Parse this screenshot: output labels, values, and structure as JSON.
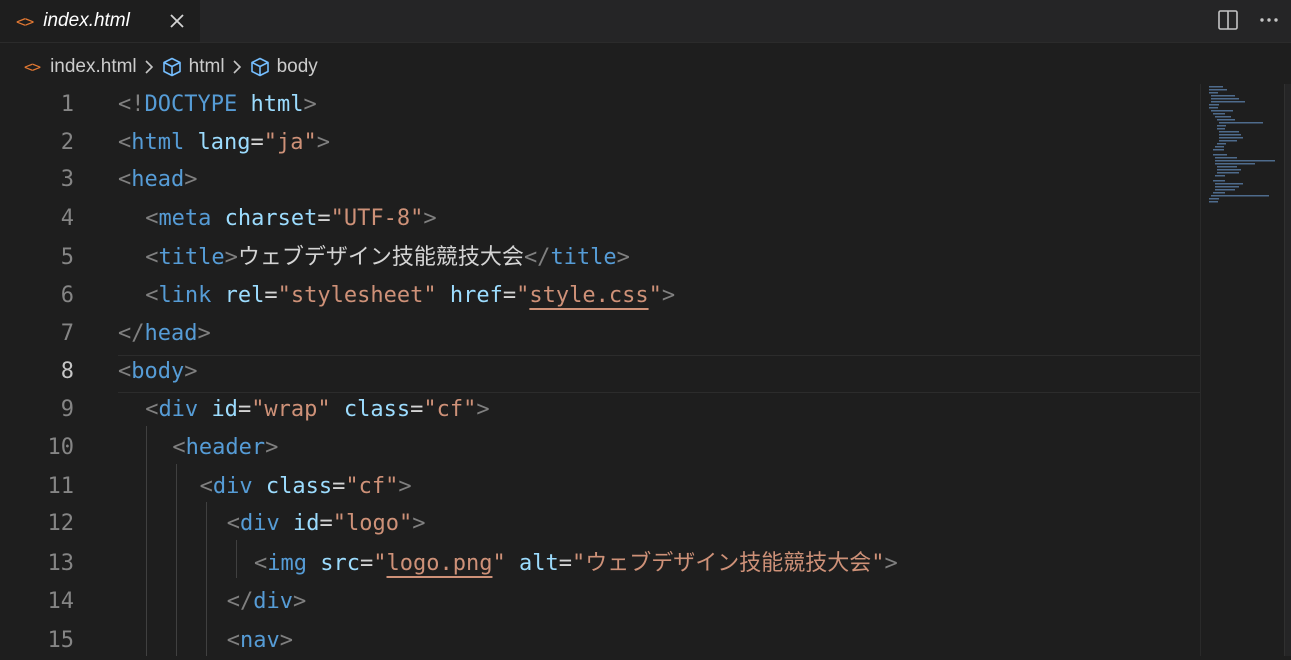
{
  "tab": {
    "label": "index.html",
    "icon": "html-file-icon"
  },
  "breadcrumb": {
    "file": "index.html",
    "items": [
      "html",
      "body"
    ]
  },
  "lines": [
    {
      "n": "1",
      "indent": 0,
      "tokens": [
        [
          "p",
          "<!"
        ],
        [
          "t",
          "DOCTYPE"
        ],
        [
          "e",
          " "
        ],
        [
          "a",
          "html"
        ],
        [
          "p",
          ">"
        ]
      ]
    },
    {
      "n": "2",
      "indent": 0,
      "tokens": [
        [
          "p",
          "<"
        ],
        [
          "t",
          "html"
        ],
        [
          "e",
          " "
        ],
        [
          "a",
          "lang"
        ],
        [
          "e",
          "="
        ],
        [
          "s",
          "\"ja\""
        ],
        [
          "p",
          ">"
        ]
      ]
    },
    {
      "n": "3",
      "indent": 0,
      "tokens": [
        [
          "p",
          "<"
        ],
        [
          "t",
          "head"
        ],
        [
          "p",
          ">"
        ]
      ]
    },
    {
      "n": "4",
      "indent": 2,
      "tokens": [
        [
          "p",
          "<"
        ],
        [
          "t",
          "meta"
        ],
        [
          "e",
          " "
        ],
        [
          "a",
          "charset"
        ],
        [
          "e",
          "="
        ],
        [
          "s",
          "\"UTF-8\""
        ],
        [
          "p",
          ">"
        ]
      ]
    },
    {
      "n": "5",
      "indent": 2,
      "tokens": [
        [
          "p",
          "<"
        ],
        [
          "t",
          "title"
        ],
        [
          "p",
          ">"
        ],
        [
          "tx",
          "ウェブデザイン技能競技大会"
        ],
        [
          "p",
          "</"
        ],
        [
          "t",
          "title"
        ],
        [
          "p",
          ">"
        ]
      ]
    },
    {
      "n": "6",
      "indent": 2,
      "tokens": [
        [
          "p",
          "<"
        ],
        [
          "t",
          "link"
        ],
        [
          "e",
          " "
        ],
        [
          "a",
          "rel"
        ],
        [
          "e",
          "="
        ],
        [
          "s",
          "\"stylesheet\""
        ],
        [
          "e",
          " "
        ],
        [
          "a",
          "href"
        ],
        [
          "e",
          "="
        ],
        [
          "s",
          "\""
        ],
        [
          "su",
          "style.css"
        ],
        [
          "s",
          "\""
        ],
        [
          "p",
          ">"
        ]
      ]
    },
    {
      "n": "7",
      "indent": 0,
      "tokens": [
        [
          "p",
          "</"
        ],
        [
          "t",
          "head"
        ],
        [
          "p",
          ">"
        ]
      ]
    },
    {
      "n": "8",
      "indent": 0,
      "tokens": [
        [
          "p",
          "<"
        ],
        [
          "t",
          "body"
        ],
        [
          "p",
          ">"
        ]
      ]
    },
    {
      "n": "9",
      "indent": 2,
      "tokens": [
        [
          "p",
          "<"
        ],
        [
          "t",
          "div"
        ],
        [
          "e",
          " "
        ],
        [
          "a",
          "id"
        ],
        [
          "e",
          "="
        ],
        [
          "s",
          "\"wrap\""
        ],
        [
          "e",
          " "
        ],
        [
          "a",
          "class"
        ],
        [
          "e",
          "="
        ],
        [
          "s",
          "\"cf\""
        ],
        [
          "p",
          ">"
        ]
      ]
    },
    {
      "n": "10",
      "indent": 4,
      "tokens": [
        [
          "p",
          "<"
        ],
        [
          "t",
          "header"
        ],
        [
          "p",
          ">"
        ]
      ]
    },
    {
      "n": "11",
      "indent": 6,
      "tokens": [
        [
          "p",
          "<"
        ],
        [
          "t",
          "div"
        ],
        [
          "e",
          " "
        ],
        [
          "a",
          "class"
        ],
        [
          "e",
          "="
        ],
        [
          "s",
          "\"cf\""
        ],
        [
          "p",
          ">"
        ]
      ]
    },
    {
      "n": "12",
      "indent": 8,
      "tokens": [
        [
          "p",
          "<"
        ],
        [
          "t",
          "div"
        ],
        [
          "e",
          " "
        ],
        [
          "a",
          "id"
        ],
        [
          "e",
          "="
        ],
        [
          "s",
          "\"logo\""
        ],
        [
          "p",
          ">"
        ]
      ]
    },
    {
      "n": "13",
      "indent": 10,
      "tokens": [
        [
          "p",
          "<"
        ],
        [
          "t",
          "img"
        ],
        [
          "e",
          " "
        ],
        [
          "a",
          "src"
        ],
        [
          "e",
          "="
        ],
        [
          "s",
          "\""
        ],
        [
          "su",
          "logo.png"
        ],
        [
          "s",
          "\""
        ],
        [
          "e",
          " "
        ],
        [
          "a",
          "alt"
        ],
        [
          "e",
          "="
        ],
        [
          "s",
          "\"ウェブデザイン技能競技大会\""
        ],
        [
          "p",
          ">"
        ]
      ]
    },
    {
      "n": "14",
      "indent": 8,
      "tokens": [
        [
          "p",
          "</"
        ],
        [
          "t",
          "div"
        ],
        [
          "p",
          ">"
        ]
      ]
    },
    {
      "n": "15",
      "indent": 8,
      "tokens": [
        [
          "p",
          "<"
        ],
        [
          "t",
          "nav"
        ],
        [
          "p",
          ">"
        ]
      ]
    }
  ],
  "active_line": "8"
}
